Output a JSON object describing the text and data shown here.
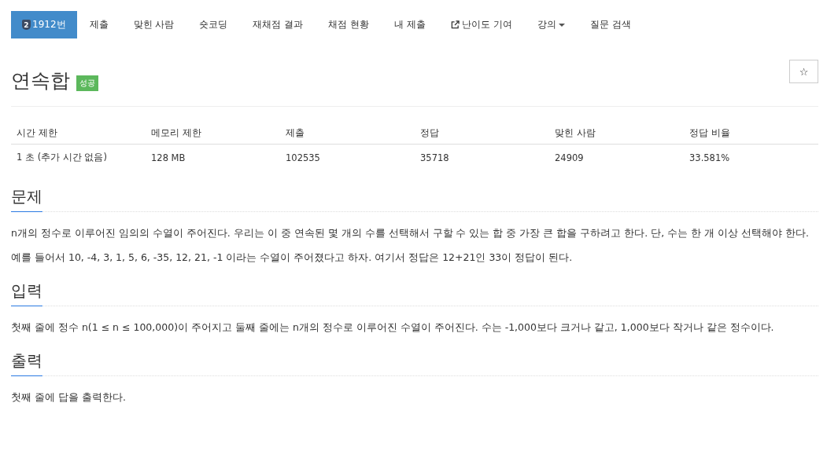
{
  "nav": [
    {
      "label": "1912번",
      "badge": "2",
      "kind": "problem",
      "selected": true
    },
    {
      "label": "제출",
      "kind": "plain",
      "selected": false
    },
    {
      "label": "맞힌 사람",
      "kind": "plain",
      "selected": false
    },
    {
      "label": "숏코딩",
      "kind": "plain",
      "selected": false
    },
    {
      "label": "재채점 결과",
      "kind": "plain",
      "selected": false
    },
    {
      "label": "채점 현황",
      "kind": "plain",
      "selected": false
    },
    {
      "label": "내 제출",
      "kind": "plain",
      "selected": false
    },
    {
      "label": "난이도 기여",
      "kind": "external",
      "selected": false
    },
    {
      "label": "강의",
      "kind": "dropdown",
      "selected": false
    },
    {
      "label": "질문 검색",
      "kind": "plain",
      "selected": false
    }
  ],
  "title": "연속합",
  "status_label": "성공",
  "starred": false,
  "star_symbol": "☆",
  "info_table": {
    "columns": [
      "시간 제한",
      "메모리 제한",
      "제출",
      "정답",
      "맞힌 사람",
      "정답 비율"
    ],
    "rows": [
      [
        "1 초 (추가 시간 없음)",
        "128 MB",
        "102535",
        "35718",
        "24909",
        "33.581%"
      ]
    ]
  },
  "sections": [
    {
      "heading": "문제",
      "paragraphs": [
        "n개의 정수로 이루어진 임의의 수열이 주어진다. 우리는 이 중 연속된 몇 개의 수를 선택해서 구할 수 있는 합 중 가장 큰 합을 구하려고 한다. 단, 수는 한 개 이상 선택해야 한다.",
        "예를 들어서 10, -4, 3, 1, 5, 6, -35, 12, 21, -1 이라는 수열이 주어졌다고 하자. 여기서 정답은 12+21인 33이 정답이 된다."
      ]
    },
    {
      "heading": "입력",
      "paragraphs": [
        "첫째 줄에 정수 n(1 ≤ n ≤ 100,000)이 주어지고 둘째 줄에는 n개의 정수로 이루어진 수열이 주어진다. 수는 -1,000보다 크거나 같고, 1,000보다 작거나 같은 정수이다."
      ]
    },
    {
      "heading": "출력",
      "paragraphs": [
        "첫째 줄에 답을 출력한다."
      ]
    }
  ]
}
